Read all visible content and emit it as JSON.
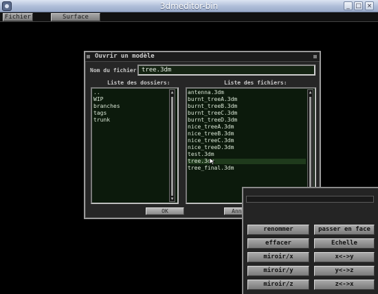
{
  "window": {
    "title": "3dmeditor-bin",
    "controls": [
      "minimize",
      "maximize",
      "close"
    ]
  },
  "menubar": {
    "items": [
      "Fichier",
      "Surface"
    ]
  },
  "dialog": {
    "title": "Ouvrir un modèle",
    "filename_label": "Nom du fichier:",
    "filename_value": "tree.3dm",
    "folders_header": "Liste des dossiers:",
    "files_header": "Liste des fichiers:",
    "folders": [
      "..",
      "WIP",
      "branches",
      "tags",
      "trunk"
    ],
    "files": [
      "antenna.3dm",
      "burnt_treeA.3dm",
      "burnt_treeB.3dm",
      "burnt_treeC.3dm",
      "burnt_treeD.3dm",
      "nice_treeA.3dm",
      "nice_treeB.3dm",
      "nice_treeC.3dm",
      "nice_treeD.3dm",
      "test.3dm",
      "tree.3dm",
      "tree_final.3dm"
    ],
    "selected_file": "tree.3dm",
    "ok_label": "OK",
    "cancel_label": "Annuler"
  },
  "tools": {
    "rename": "renommer",
    "face": "passer en face",
    "erase": "effacer",
    "scale": "Echelle",
    "mirror_x": "miroir/x",
    "swap_xy": "x<->y",
    "mirror_y": "miroir/y",
    "swap_yz": "y<->z",
    "mirror_z": "miroir/z",
    "swap_zx": "z<->x"
  },
  "colors": {
    "list_bg": "#0c1a0c",
    "selection": "#1f3a1c",
    "panel": "#262626",
    "button": "#9a9a9a"
  }
}
